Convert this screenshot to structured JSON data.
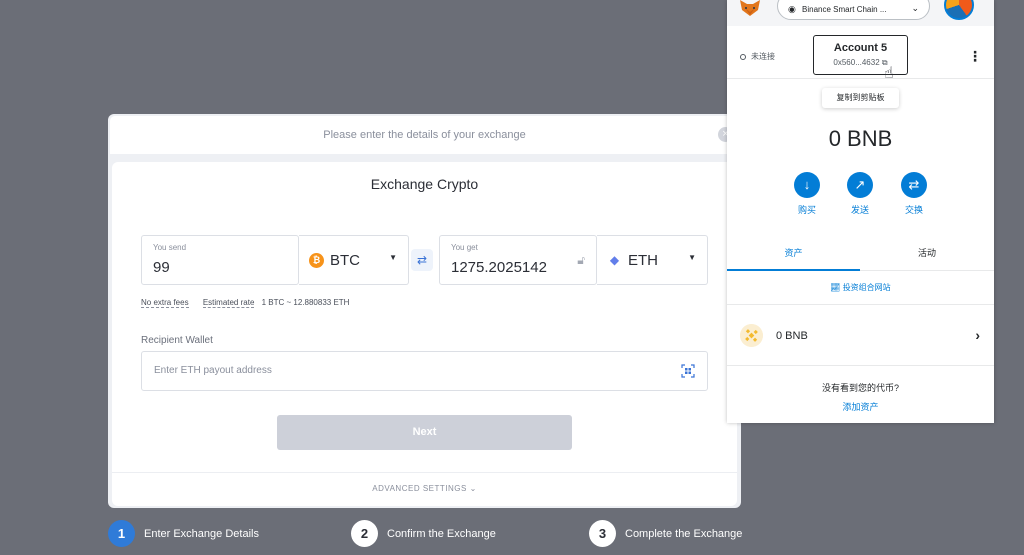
{
  "exchange": {
    "header_text": "Please enter the details of your exchange",
    "close_label": "×",
    "title": "Exchange Crypto",
    "send": {
      "label": "You send",
      "value": "99",
      "currency": "BTC",
      "coin_symbol": "₿"
    },
    "get": {
      "label": "You get",
      "value": "1275.2025142",
      "currency": "ETH",
      "coin_symbol": "◆"
    },
    "swap_icon": "⇄",
    "no_fees": "No extra fees",
    "estimated_rate_label": "Estimated rate",
    "estimated_rate_value": "1 BTC ~ 12.880833 ETH",
    "recipient_label": "Recipient Wallet",
    "recipient_placeholder": "Enter ETH payout address",
    "next_label": "Next",
    "advanced_settings": "ADVANCED SETTINGS",
    "advanced_caret": "⌄"
  },
  "steps": [
    {
      "num": "1",
      "label": "Enter Exchange Details"
    },
    {
      "num": "2",
      "label": "Confirm the Exchange"
    },
    {
      "num": "3",
      "label": "Complete the Exchange"
    }
  ],
  "wallet": {
    "network_name": "Binance Smart Chain ...",
    "status": "未连接",
    "account_name": "Account 5",
    "account_address": "0x560...4632",
    "copy_tooltip": "复制到剪贴板",
    "balance": "0 BNB",
    "actions": [
      {
        "label": "购买",
        "icon": "↓"
      },
      {
        "label": "发送",
        "icon": "↗"
      },
      {
        "label": "交换",
        "icon": "⇄"
      }
    ],
    "tabs": [
      "资产",
      "活动"
    ],
    "portfolio_link": "投资组合网站",
    "asset_name": "0 BNB",
    "notice": "没有看到您的代币?",
    "add_asset": "添加资产"
  },
  "colors": {
    "accent_blue": "#037dd6",
    "btc_orange": "#f7931a",
    "bnb_yellow": "#f3ba2f"
  },
  "icons": [
    "close-icon",
    "btc-icon",
    "eth-icon",
    "swap-icon",
    "lock-icon",
    "qr-scan-icon",
    "metamask-fox-icon",
    "network-icon",
    "copy-icon",
    "kebab-menu-icon",
    "download-icon",
    "send-arrow-icon",
    "chart-icon",
    "bnb-icon",
    "chevron-right-icon"
  ]
}
